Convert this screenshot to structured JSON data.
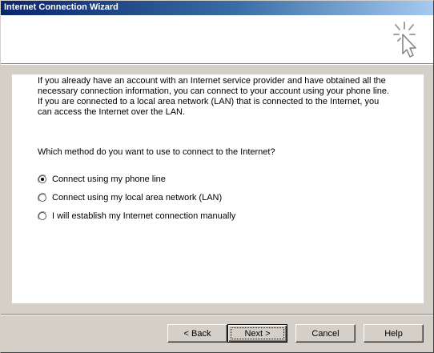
{
  "window": {
    "title": "Internet Connection Wizard"
  },
  "header": {
    "graphic_icon": "wizard-sparkle-cursor-icon"
  },
  "content": {
    "intro": "If you already have an account with an Internet service provider and have obtained all the necessary connection information, you can connect to your account using your phone line. If you are connected to a local area network (LAN) that is connected to the Internet, you can access the Internet over the LAN.",
    "question": "Which method do you want to use to connect to the Internet?",
    "options": [
      {
        "label": "Connect using my phone line",
        "selected": true
      },
      {
        "label": "Connect using my local area network (LAN)",
        "selected": false
      },
      {
        "label": "I will establish my Internet connection manually",
        "selected": false
      }
    ]
  },
  "buttons": {
    "back": "< Back",
    "next": "Next >",
    "cancel": "Cancel",
    "help": "Help"
  },
  "colors": {
    "titlebar_start": "#0a246a",
    "titlebar_end": "#a6caf0",
    "face": "#d4d0c8",
    "content_bg": "#ffffff"
  }
}
